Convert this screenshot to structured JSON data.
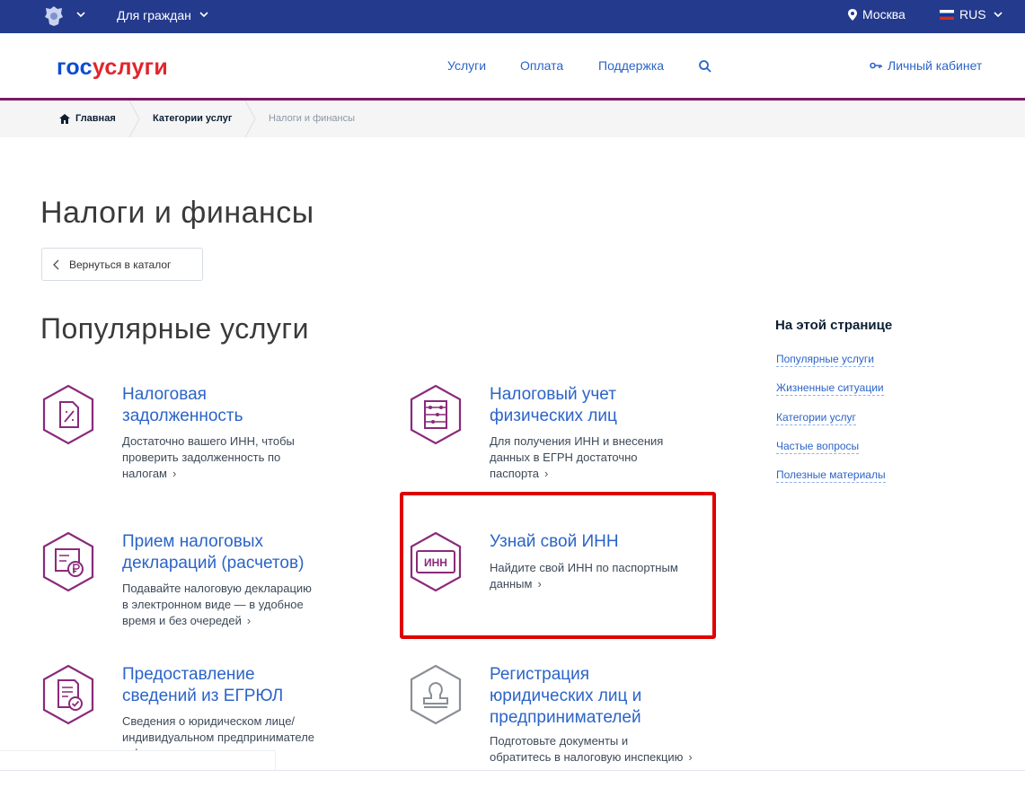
{
  "topbar": {
    "citizens_label": "Для граждан",
    "city": "Москва",
    "lang": "RUS",
    "icons": [
      "emblem-icon",
      "chevron-down-icon",
      "location-pin-icon",
      "flag-icon"
    ]
  },
  "header": {
    "logo_part1": "гос",
    "logo_part2": "услуги",
    "nav": [
      "Услуги",
      "Оплата",
      "Поддержка"
    ],
    "cabinet_label": "Личный кабинет"
  },
  "breadcrumb": {
    "home": "Главная",
    "categories": "Категории услуг",
    "current": "Налоги и финансы"
  },
  "page": {
    "title": "Налоги и финансы",
    "back_label": "Вернуться в каталог",
    "popular_title": "Популярные услуги"
  },
  "services": [
    {
      "title_line1": "Налоговая",
      "title_line2": "задолженность",
      "desc_line1": "Достаточно вашего ИНН, чтобы",
      "desc_line2": "проверить задолженность по",
      "desc_line3": "налогам"
    },
    {
      "title_line1": "Налоговый учет",
      "title_line2": "физических лиц",
      "desc_line1": "Для получения ИНН и внесения",
      "desc_line2": "данных в ЕГРН достаточно",
      "desc_line3": "паспорта"
    },
    {
      "title_line1": "Прием налоговых",
      "title_line2": "деклараций (расчетов)",
      "desc_line1": "Подавайте налоговую декларацию",
      "desc_line2": "в электронном виде — в удобное",
      "desc_line3": "время и без очередей"
    },
    {
      "title_line1": "Узнай свой ИНН",
      "desc_line1": "Найдите свой ИНН по паспортным",
      "desc_line2": "данным",
      "icon_text": "ИНН"
    },
    {
      "title_line1": "Предоставление",
      "title_line2": "сведений из ЕГРЮЛ",
      "desc_line1": "Сведения о юридическом лице/",
      "desc_line2": "индивидуальном предпринимателе",
      "desc_line3": "в форме документа"
    },
    {
      "title_line1": "Регистрация",
      "title_line2": "юридических лиц и",
      "title_line3": "предпринимателей",
      "desc_line1": "Подготовьте документы и",
      "desc_line2": "обратитесь в налоговую инспекцию"
    }
  ],
  "aside": {
    "title": "На этой странице",
    "links": [
      "Популярные услуги",
      "Жизненные ситуации",
      "Категории услуг",
      "Частые вопросы",
      "Полезные материалы"
    ]
  },
  "colors": {
    "topbar": "#233a8d",
    "link_blue": "#2b64c8",
    "accent_purple": "#7a1b66",
    "logo_red": "#e3242b",
    "highlight_red": "#e00000"
  }
}
